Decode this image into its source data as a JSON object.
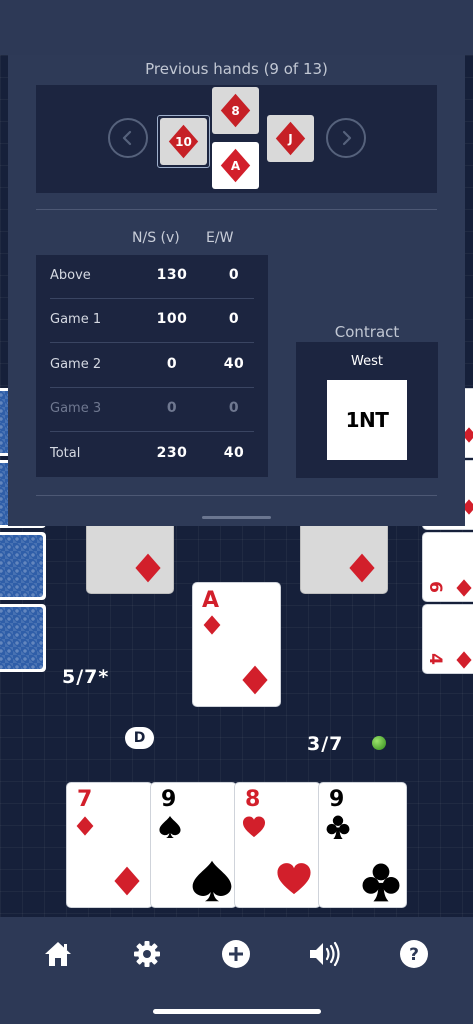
{
  "overlay": {
    "title": "Previous hands (9 of 13)",
    "trick_cards": [
      {
        "rank": "10",
        "suit": "diamond",
        "position": "west"
      },
      {
        "rank": "8",
        "suit": "diamond",
        "position": "north"
      },
      {
        "rank": "A",
        "suit": "diamond",
        "position": "south"
      },
      {
        "rank": "J",
        "suit": "diamond",
        "position": "east"
      }
    ],
    "score": {
      "headers": {
        "ns": "N/S (v)",
        "ew": "E/W"
      },
      "rows": [
        {
          "label": "Above",
          "ns": "130",
          "ew": "0"
        },
        {
          "label": "Game 1",
          "ns": "100",
          "ew": "0"
        },
        {
          "label": "Game 2",
          "ns": "0",
          "ew": "40"
        },
        {
          "label": "Game 3",
          "ns": "0",
          "ew": "0"
        },
        {
          "label": "Total",
          "ns": "230",
          "ew": "40"
        }
      ]
    },
    "contract": {
      "title": "Contract",
      "declarer": "West",
      "bid": "1NT"
    }
  },
  "table": {
    "played_card": {
      "rank": "A",
      "suit": "diamond"
    },
    "east_cards": [
      {
        "rank": "6"
      },
      {
        "rank": "4"
      }
    ],
    "ns_tricks": "5/7*",
    "ew_tricks": "3/7",
    "dealer_badge": "D",
    "hand": [
      {
        "rank": "7",
        "suit": "diamond",
        "color": "red"
      },
      {
        "rank": "9",
        "suit": "spade",
        "color": "black"
      },
      {
        "rank": "8",
        "suit": "heart",
        "color": "red"
      },
      {
        "rank": "9",
        "suit": "club",
        "color": "black"
      }
    ]
  },
  "nav": {
    "icons": [
      "home-icon",
      "settings-icon",
      "new-game-icon",
      "sound-icon",
      "help-icon"
    ]
  },
  "colors": {
    "background": "#16203a",
    "panel": "#2e3a57",
    "red_suit": "#d21f2b",
    "card_red": "#d21f2b"
  }
}
